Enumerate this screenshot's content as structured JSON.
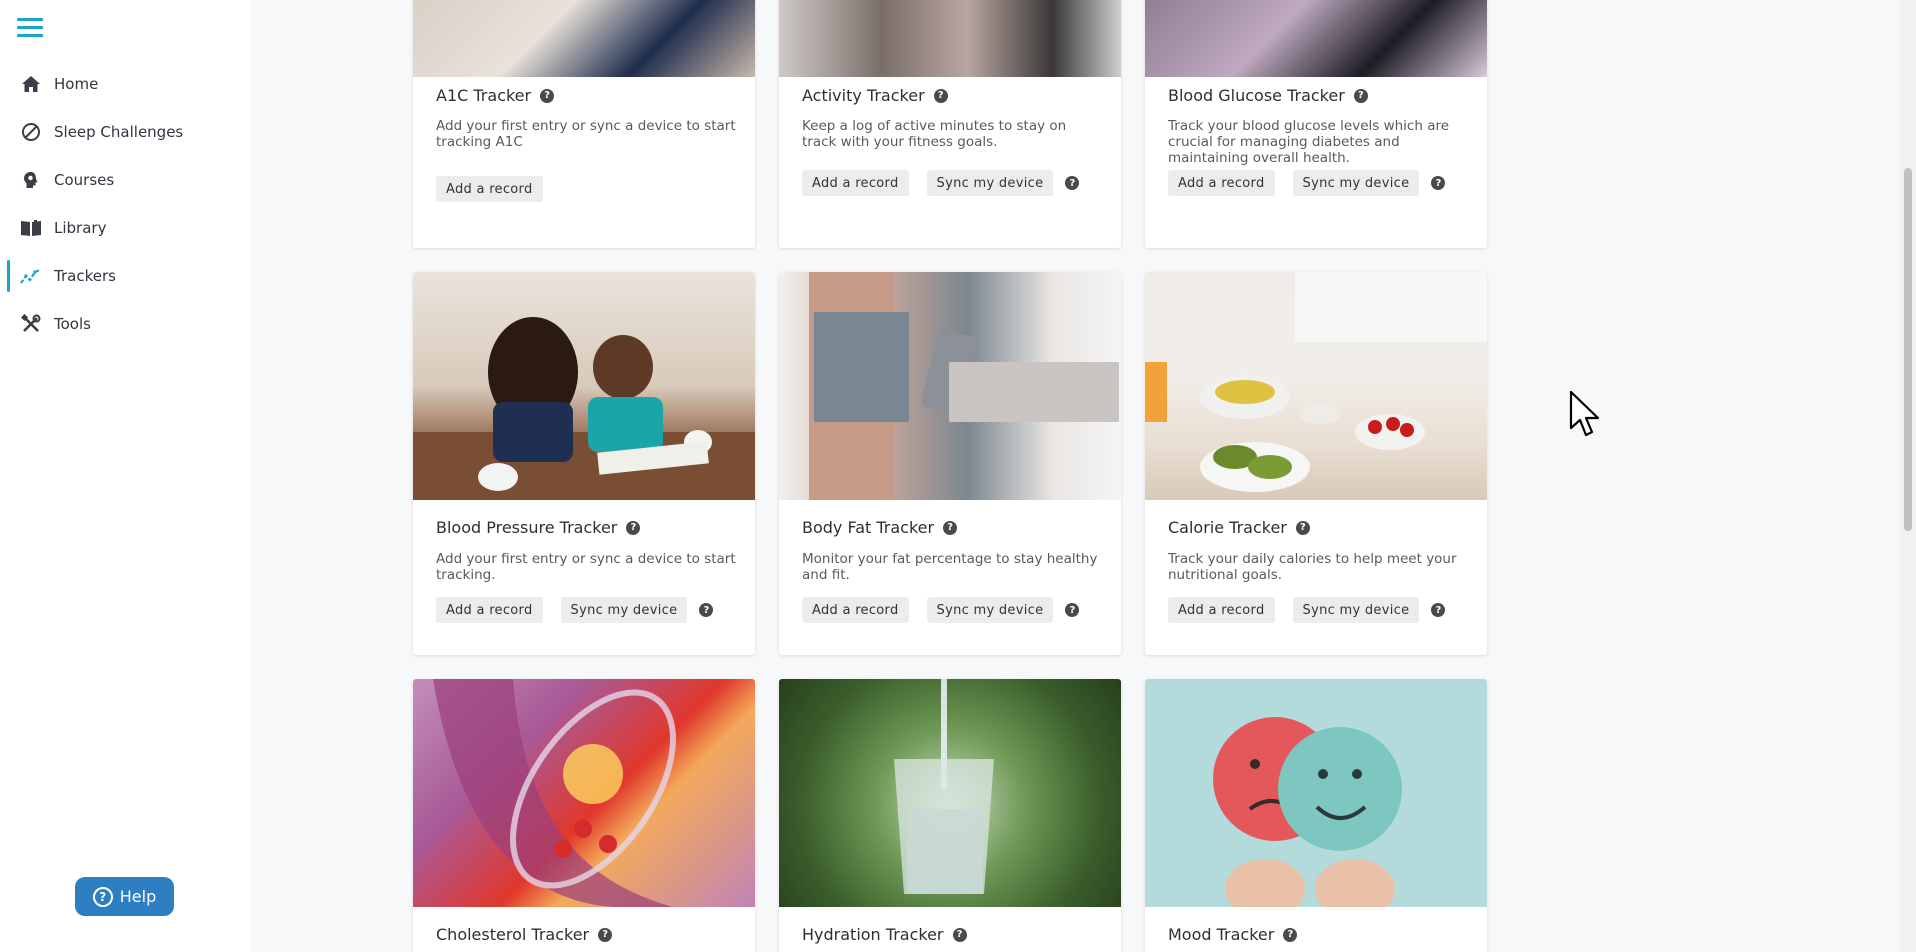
{
  "sidebar": {
    "items": [
      {
        "label": "Home",
        "icon": "home-icon"
      },
      {
        "label": "Sleep Challenges",
        "icon": "ban-icon"
      },
      {
        "label": "Courses",
        "icon": "lightbulb-head-icon"
      },
      {
        "label": "Library",
        "icon": "book-icon"
      },
      {
        "label": "Trackers",
        "icon": "trend-chart-icon"
      },
      {
        "label": "Tools",
        "icon": "tools-icon"
      }
    ],
    "active": "Trackers",
    "help_label": "Help",
    "accent_color": "#1ea4c8",
    "help_color": "#2d7fc1"
  },
  "cards": [
    {
      "title": "A1C Tracker",
      "desc": "Add your first entry or sync a device to start tracking A1C",
      "add": "Add a record"
    },
    {
      "title": "Activity Tracker",
      "desc": "Keep a log of active minutes to stay on track with your fitness goals.",
      "add": "Add a record",
      "sync": "Sync my device"
    },
    {
      "title": "Blood Glucose Tracker",
      "desc": "Track your blood glucose levels which are crucial for managing diabetes and maintaining overall health.",
      "add": "Add a record",
      "sync": "Sync my device"
    },
    {
      "title": "Blood Pressure Tracker",
      "desc": "Add your first entry or sync a device to start tracking.",
      "add": "Add a record",
      "sync": "Sync my device"
    },
    {
      "title": "Body Fat Tracker",
      "desc": "Monitor your fat percentage to stay healthy and fit.",
      "add": "Add a record",
      "sync": "Sync my device"
    },
    {
      "title": "Calorie Tracker",
      "desc": "Track your daily calories to help meet your nutritional goals.",
      "add": "Add a record",
      "sync": "Sync my device"
    },
    {
      "title": "Cholesterol Tracker"
    },
    {
      "title": "Hydration Tracker"
    },
    {
      "title": "Mood Tracker"
    }
  ]
}
